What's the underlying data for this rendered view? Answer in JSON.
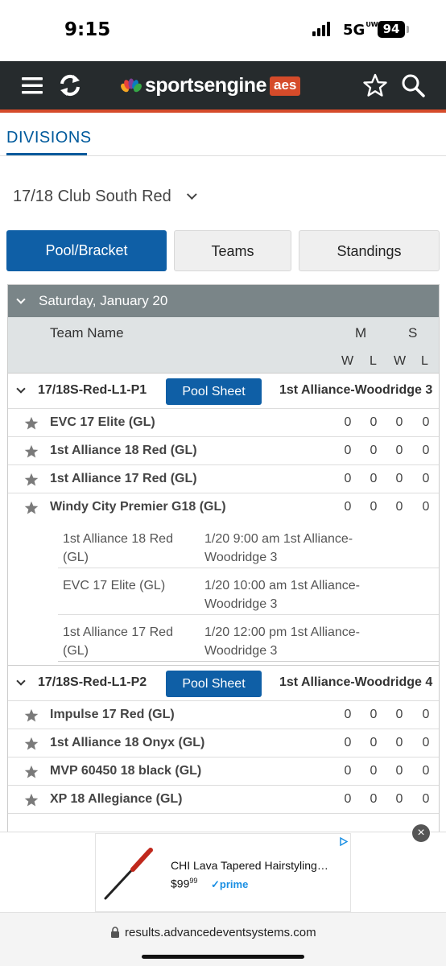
{
  "status": {
    "time": "9:15",
    "network": "5G",
    "network_sub": "UW",
    "battery": "94"
  },
  "header": {
    "brand": "sportsengine",
    "badge": "aes"
  },
  "divisions": {
    "title": "DIVISIONS",
    "selected": "17/18 Club South Red"
  },
  "tabs": [
    {
      "label": "Pool/Bracket",
      "active": true
    },
    {
      "label": "Teams",
      "active": false
    },
    {
      "label": "Standings",
      "active": false
    }
  ],
  "table": {
    "date": "Saturday, January 20",
    "col_team": "Team Name",
    "col_m": "M",
    "col_s": "S",
    "col_w": "W",
    "col_l": "L"
  },
  "pools": [
    {
      "name": "17/18S-Red-L1-P1",
      "sheet_label": "Pool Sheet",
      "site": "1st Alliance-Woodridge 3",
      "teams": [
        {
          "name": "EVC 17 Elite (GL)",
          "mw": "0",
          "ml": "0",
          "sw": "0",
          "sl": "0"
        },
        {
          "name": "1st Alliance 18 Red (GL)",
          "mw": "0",
          "ml": "0",
          "sw": "0",
          "sl": "0"
        },
        {
          "name": "1st Alliance 17 Red (GL)",
          "mw": "0",
          "ml": "0",
          "sw": "0",
          "sl": "0"
        },
        {
          "name": "Windy City Premier G18 (GL)",
          "mw": "0",
          "ml": "0",
          "sw": "0",
          "sl": "0"
        }
      ],
      "matches": [
        {
          "team": "1st Alliance 18 Red (GL)",
          "info": "1/20 9:00 am 1st Alliance-Woodridge 3"
        },
        {
          "team": "EVC 17 Elite (GL)",
          "info": "1/20 10:00 am 1st Alliance-Woodridge 3"
        },
        {
          "team": "1st Alliance 17 Red (GL)",
          "info": "1/20 12:00 pm 1st Alliance-Woodridge 3"
        }
      ]
    },
    {
      "name": "17/18S-Red-L1-P2",
      "sheet_label": "Pool Sheet",
      "site": "1st Alliance-Woodridge 4",
      "teams": [
        {
          "name": "Impulse 17 Red (GL)",
          "mw": "0",
          "ml": "0",
          "sw": "0",
          "sl": "0"
        },
        {
          "name": "1st Alliance 18 Onyx (GL)",
          "mw": "0",
          "ml": "0",
          "sw": "0",
          "sl": "0"
        },
        {
          "name": "MVP 60450 18 black (GL)",
          "mw": "0",
          "ml": "0",
          "sw": "0",
          "sl": "0"
        },
        {
          "name": "XP 18 Allegiance (GL)",
          "mw": "0",
          "ml": "0",
          "sw": "0",
          "sl": "0"
        }
      ]
    }
  ],
  "ad": {
    "title": "CHI Lava Tapered Hairstyling…",
    "price_main": "$99",
    "price_cents": "99",
    "prime": "prime"
  },
  "url": "results.advancedeventsystems.com",
  "colors": {
    "header_bg": "#262b2d",
    "accent": "#d54b2a",
    "primary": "#0f5fa6",
    "date_row": "#7a8588"
  }
}
